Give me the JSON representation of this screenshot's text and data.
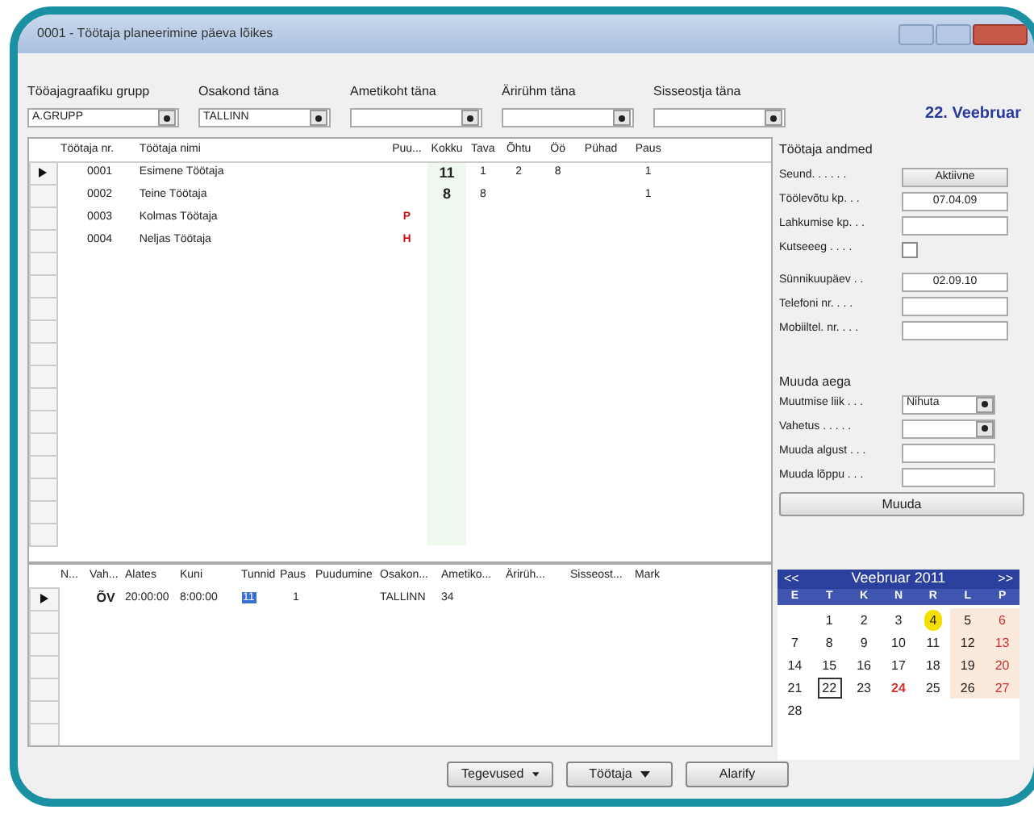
{
  "window": {
    "title": "0001 - Töötaja planeerimine päeva lõikes"
  },
  "filters": [
    {
      "label": "Tööajagraafiku grupp",
      "value": "A.GRUPP"
    },
    {
      "label": "Osakond täna",
      "value": "TALLINN"
    },
    {
      "label": "Ametikoht täna"
    },
    {
      "label": "Ärirühm täna"
    },
    {
      "label": "Sisseostja täna"
    }
  ],
  "date_heading": "22. Veebruar",
  "employees": {
    "columns": [
      "Töötaja nr.",
      "Töötaja nimi",
      "Puu...",
      "Kokku",
      "Tava",
      "Õhtu",
      "Öö",
      "Pühad",
      "Paus"
    ],
    "rows": [
      {
        "selected": true,
        "cells": [
          "0001",
          "Esimene Töötaja",
          "",
          "11",
          "1",
          "2",
          "8",
          "",
          "1"
        ]
      },
      {
        "selected": false,
        "cells": [
          "0002",
          "Teine Töötaja",
          "",
          "8",
          "8",
          "",
          "",
          "",
          "1"
        ]
      },
      {
        "selected": false,
        "cells": [
          "0003",
          "Kolmas Töötaja",
          "P",
          "",
          "",
          "",
          "",
          "",
          ""
        ]
      },
      {
        "selected": false,
        "cells": [
          "0004",
          "Neljas Töötaja",
          "H",
          "",
          "",
          "",
          "",
          "",
          ""
        ]
      }
    ]
  },
  "details": {
    "title": "Töötaja andmed",
    "fields": [
      {
        "kind": "button",
        "label": "Seund. . . . . .",
        "value": "Aktiivne"
      },
      {
        "kind": "text",
        "label": "Töölevõtu kp. . .",
        "value": "07.04.09"
      },
      {
        "kind": "text",
        "label": "Lahkumise kp. . ."
      },
      {
        "kind": "checkbox",
        "label": "Kutseeeg . . . .",
        "checked": false
      },
      {
        "kind": "text",
        "label": "Sünnikuupäev . .",
        "value": "02.09.10"
      },
      {
        "kind": "text",
        "label": "Telefoni nr. . . ."
      },
      {
        "kind": "text",
        "label": "Mobiiltel. nr. . . ."
      }
    ]
  },
  "change_time": {
    "title": "Muuda aega",
    "fields": [
      {
        "kind": "dropdown",
        "label": "Muutmise liik . . .",
        "value": "Nihuta"
      },
      {
        "kind": "dropdown",
        "label": "Vahetus . . . . ."
      },
      {
        "kind": "text",
        "label": "Muuda algust . . ."
      },
      {
        "kind": "text",
        "label": "Muuda lõppu . . ."
      }
    ],
    "button": "Muuda"
  },
  "shifts": {
    "columns": [
      "N...",
      "Vah...",
      "Alates",
      "Kuni",
      "Tunnid",
      "Paus",
      "Puudumine",
      "Osakon...",
      "Ametiko...",
      "Ärirüh...",
      "Sisseost...",
      "Mark"
    ],
    "rows": [
      {
        "selected": true,
        "focused": [
          false,
          false,
          false,
          false,
          true,
          false,
          false,
          false,
          false,
          false,
          false,
          false
        ],
        "cells": [
          "",
          "ÕV",
          "20:00:00",
          "8:00:00",
          "11",
          "1",
          "",
          "TALLINN",
          "34",
          "",
          "",
          ""
        ]
      }
    ]
  },
  "calendar": {
    "prev": "<<",
    "title": "Veebruar 2011",
    "next": ">>",
    "weekdays": [
      "E",
      "T",
      "K",
      "N",
      "R",
      "L",
      "P"
    ],
    "weeks": [
      [
        {
          "day": "1",
          "today": false,
          "selected": false,
          "holiday": false
        },
        {
          "day": "2",
          "today": false,
          "selected": false,
          "holiday": false
        },
        {
          "day": "3",
          "today": false,
          "selected": false,
          "holiday": false
        },
        {
          "day": "4",
          "today": true,
          "selected": false,
          "holiday": false
        },
        {
          "day": "5",
          "today": false,
          "selected": false,
          "holiday": false
        },
        {
          "day": "6",
          "today": false,
          "selected": false,
          "holiday": false
        }
      ],
      [
        {
          "day": "7",
          "today": false,
          "selected": false,
          "holiday": false
        },
        {
          "day": "8",
          "today": false,
          "selected": false,
          "holiday": false
        },
        {
          "day": "9",
          "today": false,
          "selected": false,
          "holiday": false
        },
        {
          "day": "10",
          "today": false,
          "selected": false,
          "holiday": false
        },
        {
          "day": "11",
          "today": false,
          "selected": false,
          "holiday": false
        },
        {
          "day": "12",
          "today": false,
          "selected": false,
          "holiday": false
        },
        {
          "day": "13",
          "today": false,
          "selected": false,
          "holiday": false
        }
      ],
      [
        {
          "day": "14",
          "today": false,
          "selected": false,
          "holiday": false
        },
        {
          "day": "15",
          "today": false,
          "selected": false,
          "holiday": false
        },
        {
          "day": "16",
          "today": false,
          "selected": false,
          "holiday": false
        },
        {
          "day": "17",
          "today": false,
          "selected": false,
          "holiday": false
        },
        {
          "day": "18",
          "today": false,
          "selected": false,
          "holiday": false
        },
        {
          "day": "19",
          "today": false,
          "selected": false,
          "holiday": false
        },
        {
          "day": "20",
          "today": false,
          "selected": false,
          "holiday": false
        }
      ],
      [
        {
          "day": "21",
          "today": false,
          "selected": false,
          "holiday": false
        },
        {
          "day": "22",
          "today": false,
          "selected": true,
          "holiday": false
        },
        {
          "day": "23",
          "today": false,
          "selected": false,
          "holiday": false
        },
        {
          "day": "24",
          "today": false,
          "selected": false,
          "holiday": true
        },
        {
          "day": "25",
          "today": false,
          "selected": false,
          "holiday": false
        },
        {
          "day": "26",
          "today": false,
          "selected": false,
          "holiday": false
        },
        {
          "day": "27",
          "today": false,
          "selected": false,
          "holiday": false
        }
      ],
      [
        {
          "day": "28",
          "today": false,
          "selected": false,
          "holiday": false
        }
      ]
    ]
  },
  "buttons": [
    {
      "kind": "menu",
      "label": "Tegevused"
    },
    {
      "kind": "menu",
      "label": "Töötaja"
    },
    {
      "kind": "plain",
      "label": "Alarify"
    }
  ]
}
